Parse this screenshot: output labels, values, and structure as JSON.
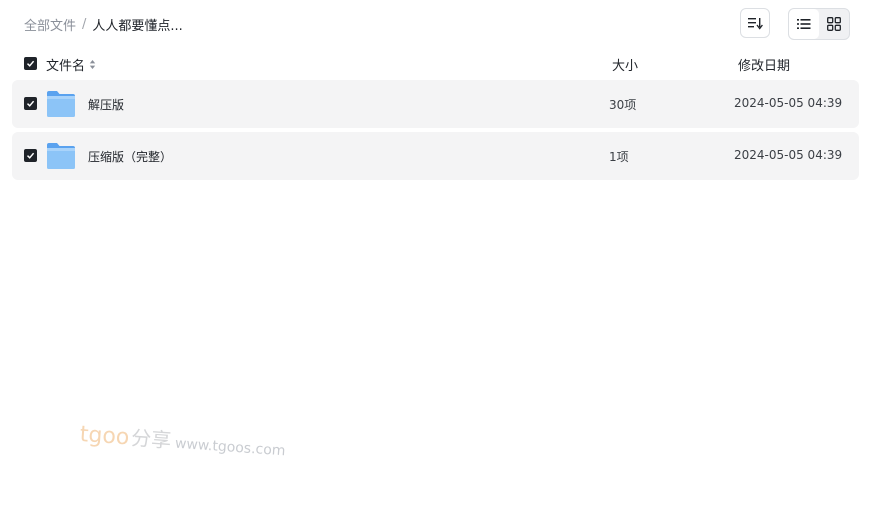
{
  "breadcrumb": {
    "root": "全部文件",
    "separator": "/",
    "current": "人人都要懂点..."
  },
  "toolbar": {
    "sort_icon": "sort-list-icon",
    "view_list_icon": "list-view-icon",
    "view_grid_icon": "grid-view-icon",
    "active_view": "list"
  },
  "table": {
    "headers": {
      "name": "文件名",
      "size": "大小",
      "date": "修改日期"
    },
    "rows": [
      {
        "name": "解压版",
        "size": "30项",
        "date": "2024-05-05 04:39",
        "checked": true,
        "icon": "folder-icon"
      },
      {
        "name": "压缩版（完整）",
        "size": "1项",
        "date": "2024-05-05 04:39",
        "checked": true,
        "icon": "folder-icon"
      }
    ]
  },
  "watermark": {
    "brand": "tgoo",
    "cn": "分享",
    "url": "www.tgoos.com"
  },
  "colors": {
    "row_bg": "#f4f4f5",
    "folder": "#7ab8f5",
    "checkbox": "#1f2329"
  }
}
